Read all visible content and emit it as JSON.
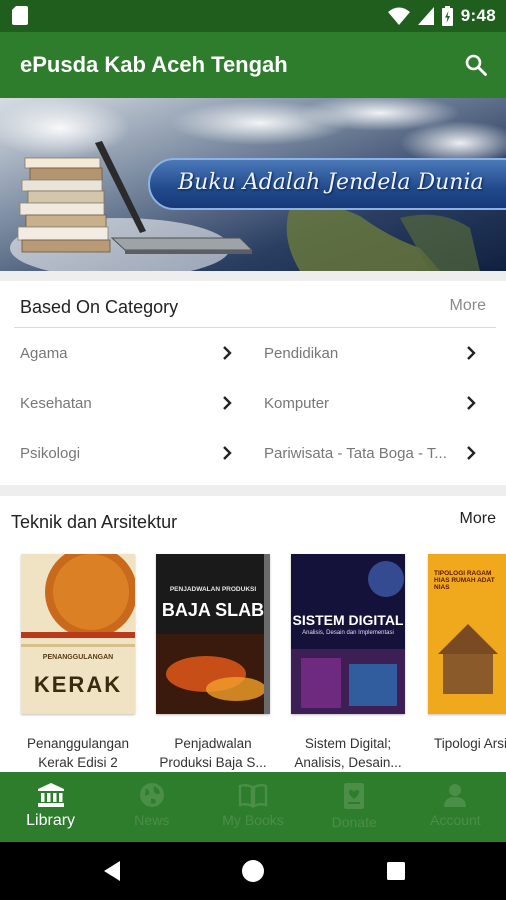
{
  "status_bar": {
    "time": "9:48"
  },
  "app_bar": {
    "title": "ePusda Kab Aceh Tengah",
    "search_icon": "search-icon"
  },
  "banner": {
    "text": "Buku Adalah Jendela Dunia"
  },
  "category": {
    "heading": "Based On Category",
    "more": "More",
    "items": [
      {
        "label": "Agama"
      },
      {
        "label": "Pendidikan"
      },
      {
        "label": "Kesehatan"
      },
      {
        "label": "Komputer"
      },
      {
        "label": "Psikologi"
      },
      {
        "label": "Pariwisata - Tata Boga - T..."
      }
    ]
  },
  "books_section": {
    "heading": "Teknik dan Arsitektur",
    "more": "More",
    "books": [
      {
        "title": "Penanggulangan Kerak Edisi 2",
        "cover_text": "PENANGGULANGAN",
        "cover_big": "KERAK"
      },
      {
        "title": "Penjadwalan Produksi Baja S...",
        "cover_text": "PENJADWALAN PRODUKSI",
        "cover_big": "BAJA SLAB"
      },
      {
        "title": "Sistem Digital; Analisis, Desain...",
        "cover_text": "SISTEM DIGITAL",
        "cover_sub": "Analisis, Desain dan Implementasi"
      },
      {
        "title": "Tipologi Arsitektur...",
        "cover_text": "TIPOLOGI RAGAM HIAS RUMAH ADAT NIAS"
      }
    ]
  },
  "bottom_nav": {
    "items": [
      {
        "label": "Library",
        "icon": "library-icon",
        "active": true
      },
      {
        "label": "News",
        "icon": "globe-icon",
        "active": false
      },
      {
        "label": "My Books",
        "icon": "open-book-icon",
        "active": false
      },
      {
        "label": "Donate",
        "icon": "donate-book-icon",
        "active": false
      },
      {
        "label": "Account",
        "icon": "account-icon",
        "active": false
      }
    ]
  },
  "colors": {
    "primary": "#2e7d2c",
    "primary_dark": "#1f5e1d",
    "inactive_nav": "#4a8e48"
  }
}
